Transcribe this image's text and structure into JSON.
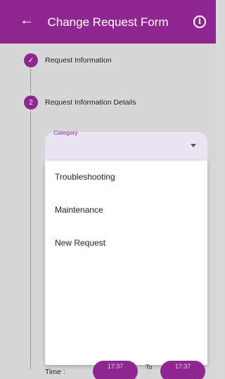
{
  "app_bar": {
    "title": "Change Request Form",
    "color": "#8e2790"
  },
  "steps": [
    {
      "label": "Request Information",
      "state": "completed",
      "icon": "check-icon"
    },
    {
      "label": "Request Information Details",
      "number": "2",
      "state": "active"
    }
  ],
  "category": {
    "label": "Category",
    "value": ""
  },
  "dropdown": {
    "options": [
      "Troubleshooting",
      "Maintenance",
      "New Request"
    ]
  },
  "time": {
    "label": "Time :",
    "start": "17:37",
    "to": "To",
    "end": "17:37"
  }
}
